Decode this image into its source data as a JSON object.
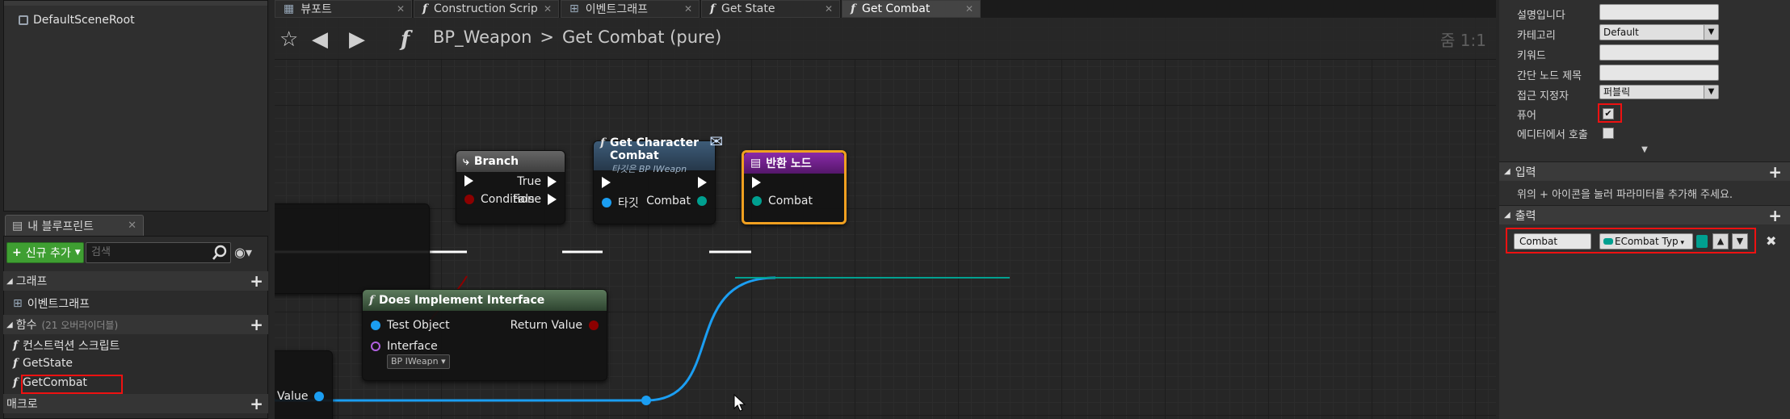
{
  "left_panel": {
    "component": "DefaultSceneRoot",
    "blueprint_tab": "내 블루프린트",
    "add_new": "신규 추가",
    "search_placeholder": "검색",
    "graphs_section": "그래프",
    "graphs": [
      "이벤트그래프"
    ],
    "functions_section": "함수",
    "functions_sub": "(21 오버라이더블)",
    "functions": [
      "컨스트럭션 스크립트",
      "GetState",
      "GetCombat"
    ],
    "macros_section": "매크로"
  },
  "tabs": [
    {
      "label": "뷰포트",
      "icon": "viewport-icon"
    },
    {
      "label": "Construction Scrip",
      "icon": "function-icon"
    },
    {
      "label": "이벤트그래프",
      "icon": "graph-icon"
    },
    {
      "label": "Get State",
      "icon": "function-icon"
    },
    {
      "label": "Get Combat",
      "icon": "function-icon",
      "active": true
    }
  ],
  "toolbar": {
    "blueprint": "BP_Weapon",
    "separator": ">",
    "function": "Get Combat (pure)",
    "zoom": "줌 1:1"
  },
  "nodes": {
    "branch": {
      "title": "Branch",
      "true": "True",
      "false": "False",
      "condition": "Condition"
    },
    "does_implement": {
      "title": "Does Implement Interface",
      "test_object": "Test Object",
      "return_value": "Return Value",
      "interface": "Interface",
      "interface_value": "BP IWeapn"
    },
    "get_char_combat": {
      "title": "Get Character Combat",
      "subtitle": "타깃은 BP IWeapn",
      "target": "타깃",
      "combat": "Combat"
    },
    "return_node": {
      "title": "반환 노드",
      "combat": "Combat"
    },
    "left_partial": {
      "value": "Value"
    }
  },
  "right_panel": {
    "props": [
      {
        "label": "설명입니다",
        "type": "input",
        "value": ""
      },
      {
        "label": "카테고리",
        "type": "select",
        "value": "Default"
      },
      {
        "label": "키워드",
        "type": "input",
        "value": ""
      },
      {
        "label": "간단 노드 제목",
        "type": "input",
        "value": ""
      },
      {
        "label": "접근 지정자",
        "type": "select",
        "value": "퍼블릭"
      },
      {
        "label": "퓨어",
        "type": "checkbox",
        "checked": true
      },
      {
        "label": "에디터에서 호출",
        "type": "checkbox",
        "checked": false
      }
    ],
    "inputs_section": "입력",
    "inputs_hint": "위의 + 아이콘을 눌러 파라미터를 추가해 주세요.",
    "outputs_section": "출력",
    "output_param": {
      "name": "Combat",
      "type": "ECombat Typ"
    }
  },
  "colors": {
    "exec": "#ffffff",
    "bool": "#8c0000",
    "object": "#1b9ef2",
    "enum": "#00a090",
    "interface": "#e8e85a",
    "return_head": "#6a1e8a",
    "pure_head": "#3a5a40",
    "branch_head": "#4a4a4a",
    "selected": "#f0a020"
  }
}
